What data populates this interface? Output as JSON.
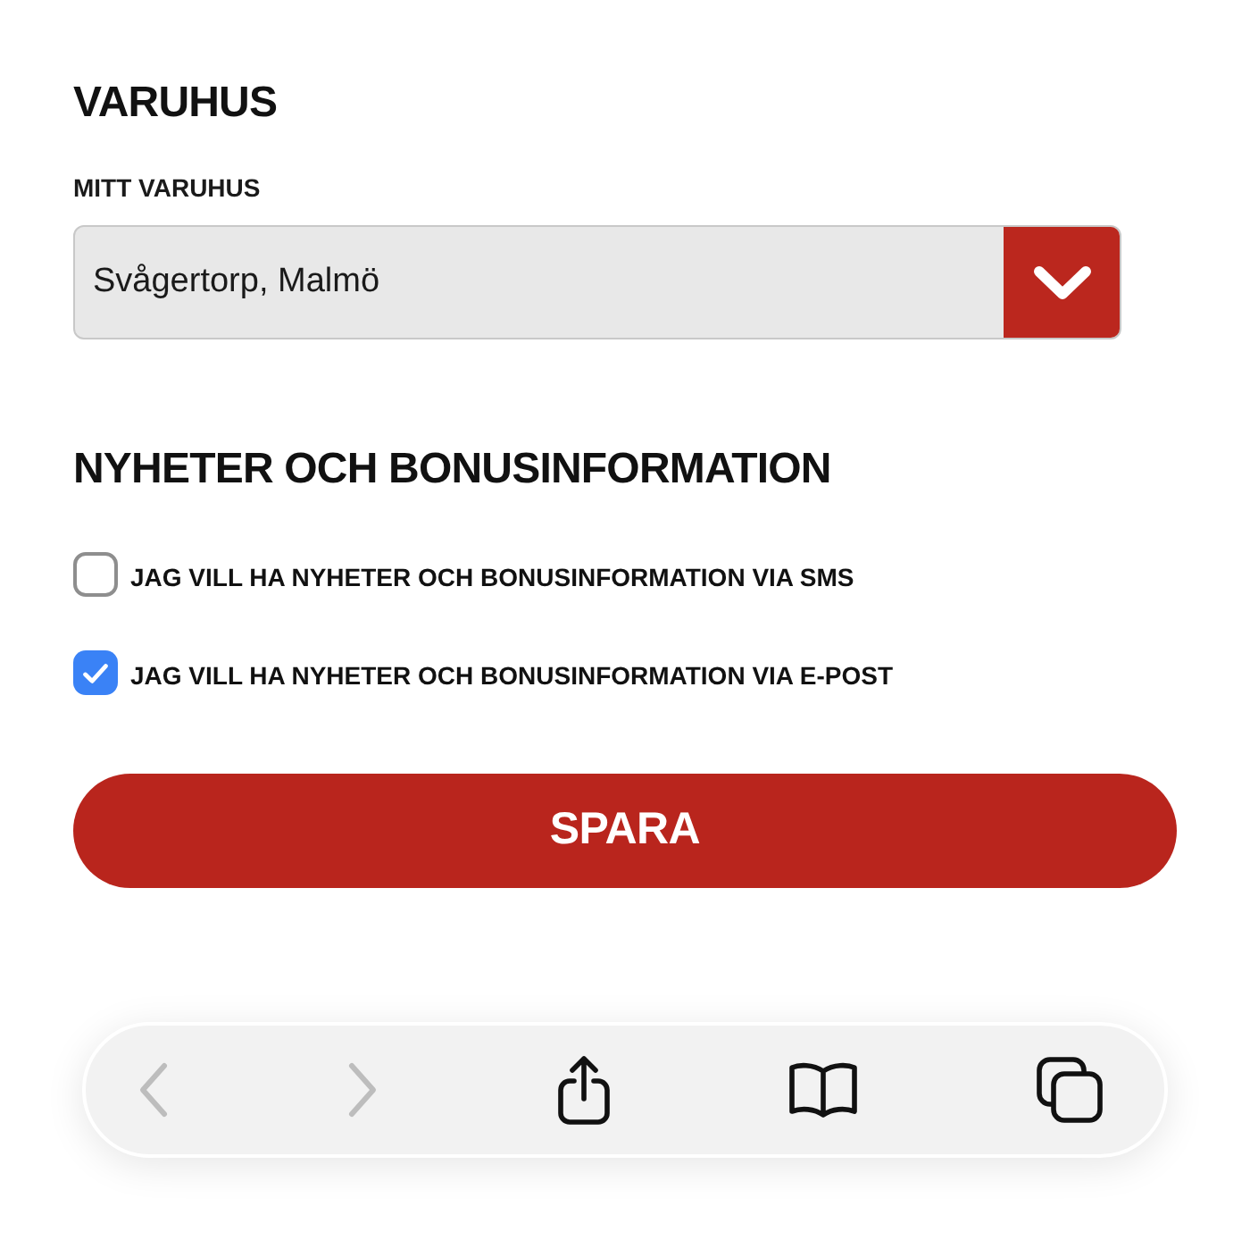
{
  "store": {
    "heading": "VARUHUS",
    "label": "MITT VARUHUS",
    "value": "Svågertorp, Malmö"
  },
  "newsletter": {
    "heading": "NYHETER OCH BONUSINFORMATION",
    "options": [
      {
        "label": "JAG VILL HA NYHETER OCH BONUSINFORMATION VIA SMS",
        "checked": false
      },
      {
        "label": "JAG VILL HA NYHETER OCH BONUSINFORMATION VIA E-POST",
        "checked": true
      }
    ]
  },
  "save_button": {
    "label": "SPARA"
  },
  "browser_toolbar": {
    "buttons": [
      {
        "kind": "back",
        "disabled": true
      },
      {
        "kind": "forward",
        "disabled": true
      },
      {
        "kind": "share",
        "disabled": false
      },
      {
        "kind": "bookmarks",
        "disabled": false
      },
      {
        "kind": "tabs",
        "disabled": false
      }
    ]
  }
}
